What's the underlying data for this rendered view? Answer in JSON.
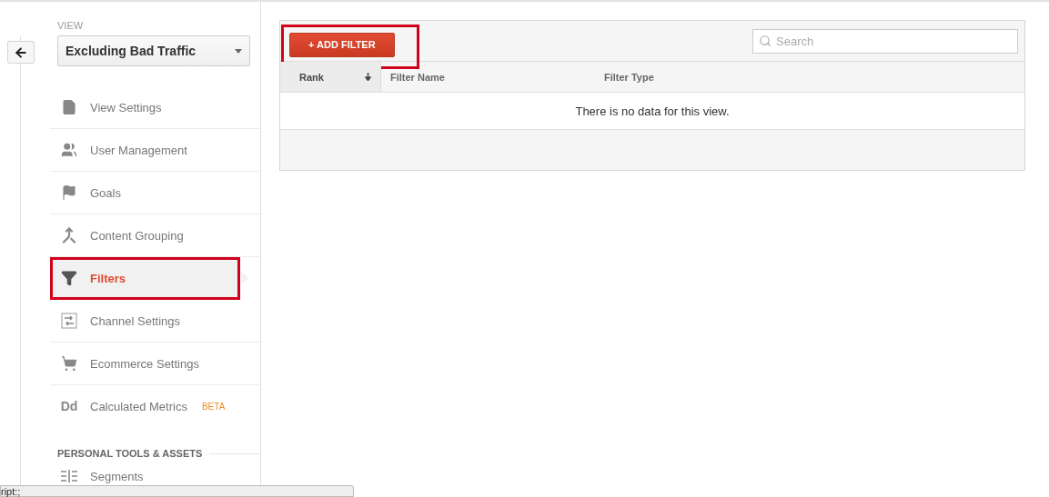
{
  "view_selector": {
    "label": "VIEW",
    "value": "Excluding Bad Traffic"
  },
  "nav_items": [
    {
      "kind": "document",
      "label": "View Settings",
      "selected": false,
      "highlighted": false
    },
    {
      "kind": "users",
      "label": "User Management",
      "selected": false,
      "highlighted": false
    },
    {
      "kind": "flag",
      "label": "Goals",
      "selected": false,
      "highlighted": false
    },
    {
      "kind": "merge",
      "label": "Content Grouping",
      "selected": false,
      "highlighted": false
    },
    {
      "kind": "funnel",
      "label": "Filters",
      "selected": true,
      "highlighted": true
    },
    {
      "kind": "channel",
      "label": "Channel Settings",
      "selected": false,
      "highlighted": false
    },
    {
      "kind": "cart",
      "label": "Ecommerce Settings",
      "selected": false,
      "highlighted": false
    },
    {
      "kind": "text",
      "icon_text": "Dd",
      "label": "Calculated Metrics",
      "badge": "BETA",
      "selected": false,
      "highlighted": false
    }
  ],
  "section_header": "PERSONAL TOOLS & ASSETS",
  "section_items": [
    {
      "kind": "segments",
      "label": "Segments",
      "selected": false,
      "highlighted": false
    }
  ],
  "toolbar": {
    "add_button": {
      "label": "+ ADD FILTER",
      "highlighted": true
    },
    "search": {
      "placeholder": "Search"
    }
  },
  "table": {
    "columns": [
      {
        "label": "Rank",
        "sorted": true
      },
      {
        "label": "Filter Name",
        "sorted": false
      },
      {
        "label": "Filter Type",
        "sorted": false
      }
    ],
    "empty_message": "There is no data for this view."
  },
  "status_bar": "ript:;"
}
